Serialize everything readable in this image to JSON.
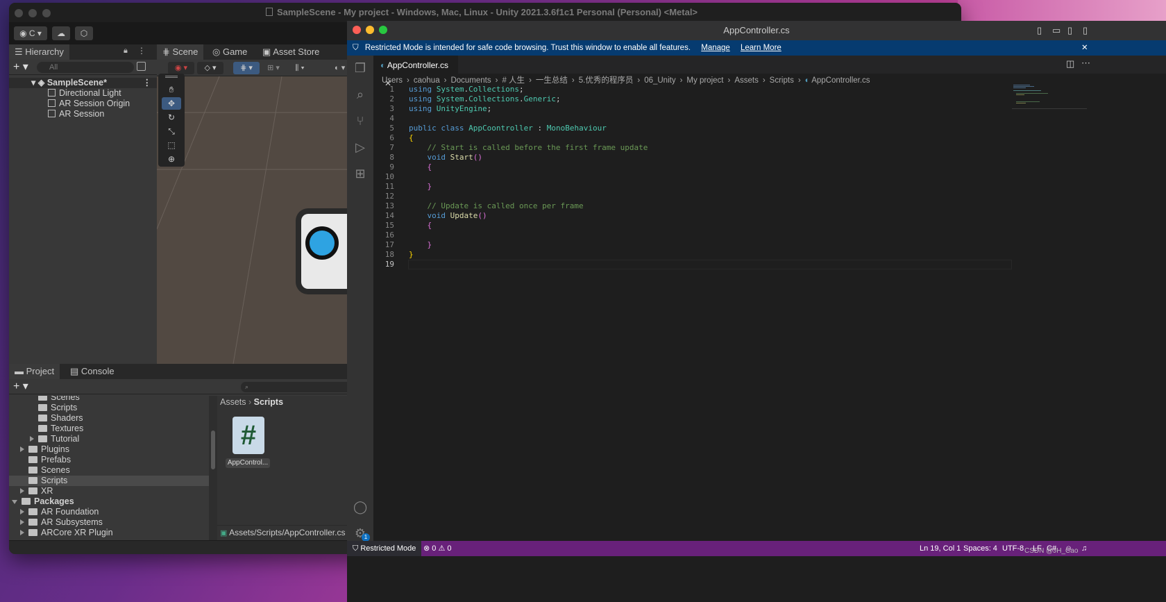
{
  "unity": {
    "title": "SampleScene - My project - Windows, Mac, Linux - Unity 2021.3.6f1c1 Personal (Personal) <Metal>",
    "account_label": "C",
    "hierarchy_tab": "Hierarchy",
    "hierarchy_search_placeholder": "All",
    "scene_root": "SampleScene*",
    "hierarchy_items": [
      "Directional Light",
      "AR Session Origin",
      "AR Session"
    ],
    "scene_tabs": [
      "Scene",
      "Game",
      "Asset Store"
    ],
    "project_tab": "Project",
    "console_tab": "Console",
    "project_folders": [
      {
        "label": "Scenes",
        "level": 3,
        "arrow": false
      },
      {
        "label": "Scripts",
        "level": 3,
        "arrow": false
      },
      {
        "label": "Shaders",
        "level": 3,
        "arrow": false
      },
      {
        "label": "Textures",
        "level": 3,
        "arrow": false
      },
      {
        "label": "Tutorial",
        "level": 3,
        "arrow": true
      },
      {
        "label": "Plugins",
        "level": 2,
        "arrow": true
      },
      {
        "label": "Prefabs",
        "level": 2,
        "arrow": false
      },
      {
        "label": "Scenes",
        "level": 2,
        "arrow": false
      },
      {
        "label": "Scripts",
        "level": 2,
        "arrow": false
      },
      {
        "label": "XR",
        "level": 2,
        "arrow": true
      },
      {
        "label": "Packages",
        "level": 1,
        "arrow": true
      },
      {
        "label": "AR Foundation",
        "level": 2,
        "arrow": true
      },
      {
        "label": "AR Subsystems",
        "level": 2,
        "arrow": true
      },
      {
        "label": "ARCore XR Plugin",
        "level": 2,
        "arrow": true
      }
    ],
    "breadcrumb_root": "Assets",
    "breadcrumb_current": "Scripts",
    "asset_name": "AppControl...",
    "asset_path": "Assets/Scripts/AppController.cs"
  },
  "vscode": {
    "title": "AppController.cs",
    "banner_text": "Restricted Mode is intended for safe code browsing. Trust this window to enable all features.",
    "banner_manage": "Manage",
    "banner_learn_more": "Learn More",
    "tab_label": "AppController.cs",
    "breadcrumbs": [
      "Users",
      "caohua",
      "Documents",
      "# 人生",
      "一生总结",
      "5.优秀的程序员",
      "06_Unity",
      "My project",
      "Assets",
      "Scripts",
      "AppController.cs"
    ],
    "code_lines": [
      "using System.Collections;",
      "using System.Collections.Generic;",
      "using UnityEngine;",
      "",
      "public class AppCoontroller : MonoBehaviour",
      "{",
      "    // Start is called before the first frame update",
      "    void Start()",
      "    {",
      "",
      "    }",
      "",
      "    // Update is called once per frame",
      "    void Update()",
      "    {",
      "",
      "    }",
      "}",
      ""
    ],
    "status": {
      "restricted": "Restricted Mode",
      "problems": "⊗ 0 ⚠ 0",
      "position": "Ln 19, Col 1",
      "spaces": "Spaces: 4",
      "encoding": "UTF-8",
      "eol": "LF",
      "language": "C#"
    },
    "settings_badge": "1"
  },
  "watermark": "CSDN @JH_Cao",
  "colors": {
    "vscode_status": "#68217a",
    "banner": "#063b70",
    "unity_bg": "#282828"
  }
}
